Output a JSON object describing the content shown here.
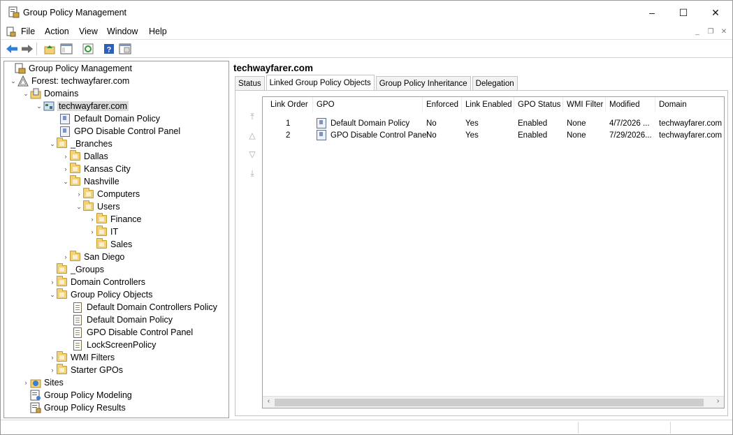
{
  "window": {
    "title": "Group Policy Management",
    "min": "–",
    "max": "☐",
    "close": "✕"
  },
  "menu": [
    "File",
    "Action",
    "View",
    "Window",
    "Help"
  ],
  "mdi": {
    "min": "_",
    "restore": "❐",
    "close": "✕"
  },
  "toolbar": {
    "back": "back",
    "forward": "forward",
    "up": "up-folder",
    "console": "show-hide-console-tree",
    "refresh": "refresh",
    "help": "help",
    "properties": "properties"
  },
  "tree": {
    "root": "Group Policy Management",
    "forest": "Forest: techwayfarer.com",
    "domains": "Domains",
    "domain": "techwayfarer.com",
    "default_domain_policy": "Default Domain Policy",
    "gpo_disable_control_panel": "GPO Disable Control Panel",
    "branches": "_Branches",
    "dallas": "Dallas",
    "kansas_city": "Kansas City",
    "nashville": "Nashville",
    "computers": "Computers",
    "users": "Users",
    "finance": "Finance",
    "it": "IT",
    "sales": "Sales",
    "san_diego": "San Diego",
    "groups": "_Groups",
    "domain_controllers": "Domain Controllers",
    "gpo_objects": "Group Policy Objects",
    "gpo_ddcp": "Default Domain Controllers Policy",
    "gpo_ddp": "Default Domain Policy",
    "gpo_dcp": "GPO Disable Control Panel",
    "gpo_lock": "LockScreenPolicy",
    "wmi_filters": "WMI Filters",
    "starter_gpos": "Starter GPOs",
    "sites": "Sites",
    "modeling": "Group Policy Modeling",
    "results": "Group Policy Results"
  },
  "right": {
    "title": "techwayfarer.com",
    "tabs": [
      "Status",
      "Linked Group Policy Objects",
      "Group Policy Inheritance",
      "Delegation"
    ],
    "columns": [
      "Link Order",
      "GPO",
      "Enforced",
      "Link Enabled",
      "GPO Status",
      "WMI Filter",
      "Modified",
      "Domain"
    ],
    "rows": [
      [
        "1",
        "Default Domain Policy",
        "No",
        "Yes",
        "Enabled",
        "None",
        "4/7/2026 ...",
        "techwayfarer.com"
      ],
      [
        "2",
        "GPO Disable Control Panel",
        "No",
        "Yes",
        "Enabled",
        "None",
        "7/29/2026...",
        "techwayfarer.com"
      ]
    ]
  }
}
